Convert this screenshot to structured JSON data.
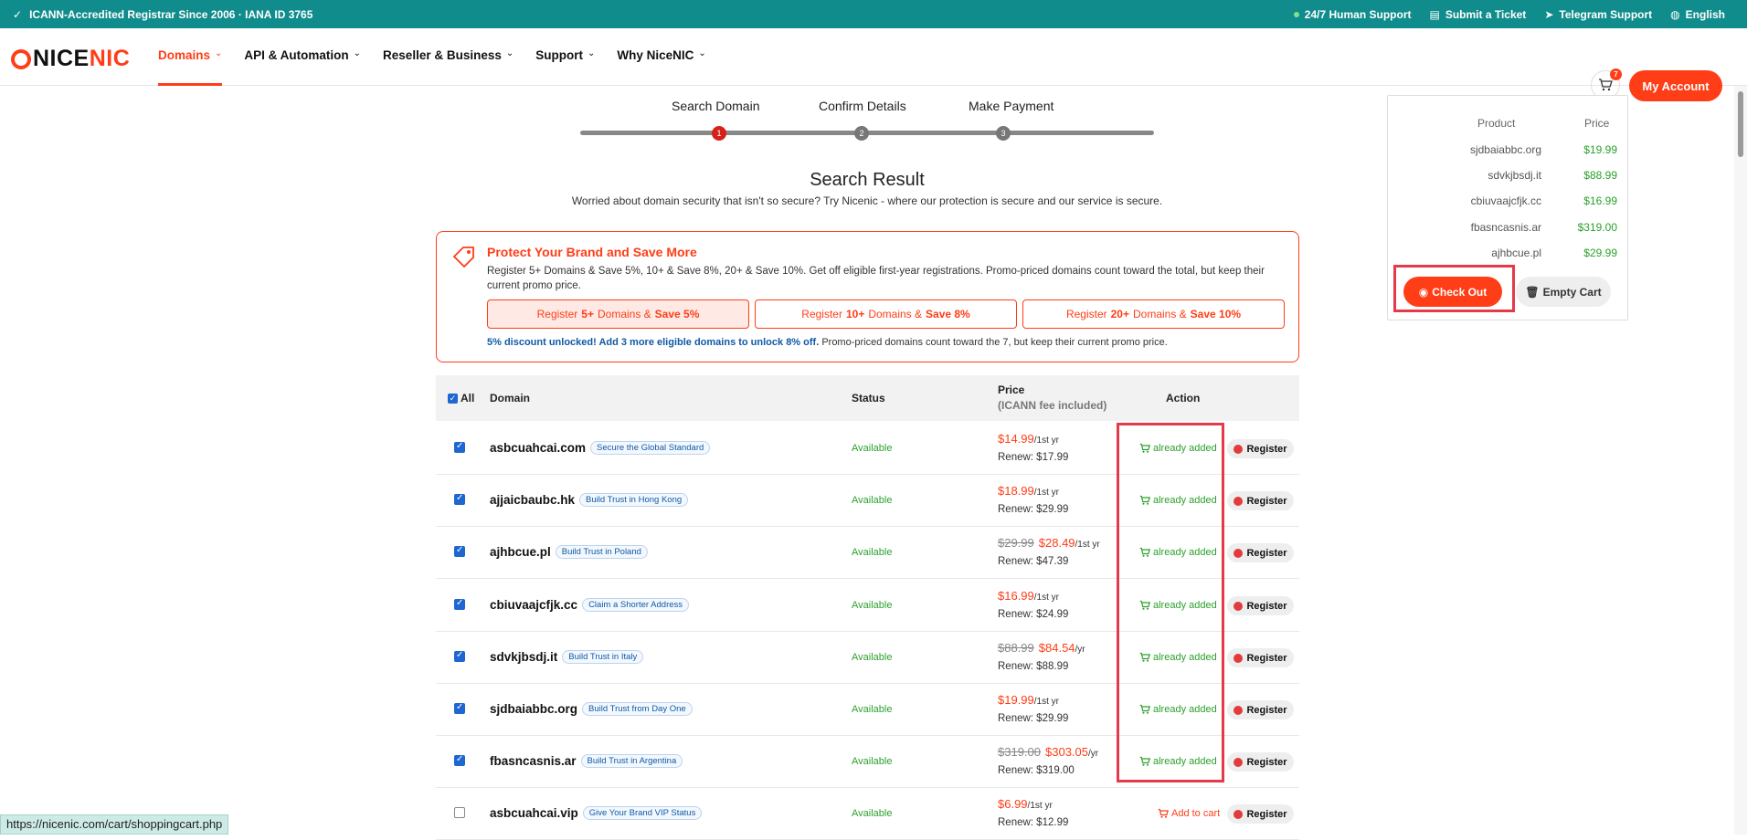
{
  "topbar": {
    "accreditation": "ICANN-Accredited Registrar Since 2006 · IANA ID 3765",
    "support": "24/7 Human Support",
    "ticket": "Submit a Ticket",
    "telegram": "Telegram Support",
    "language": "English"
  },
  "nav": {
    "logo_left": "NICE",
    "logo_right": "NIC",
    "items": [
      {
        "label": "Domains"
      },
      {
        "label": "API & Automation"
      },
      {
        "label": "Reseller & Business"
      },
      {
        "label": "Support"
      },
      {
        "label": "Why NiceNIC"
      }
    ],
    "cart_count": "7",
    "account": "My Account"
  },
  "steps": [
    "Search Domain",
    "Confirm Details",
    "Make Payment"
  ],
  "step_numbers": [
    "1",
    "2",
    "3"
  ],
  "result": {
    "title": "Search Result",
    "subtitle": "Worried about domain security that isn't so secure? Try Nicenic - where our protection is secure and our service is secure."
  },
  "promo": {
    "title": "Protect Your Brand and Save More",
    "desc": "Register 5+ Domains & Save 5%, 10+ & Save 8%, 20+ & Save 10%. Get off eligible first-year registrations. Promo-priced domains count toward the total, but keep their current promo price.",
    "tiers": [
      {
        "pre": "Register",
        "num": "5+",
        "mid": "Domains &",
        "save": "Save 5%"
      },
      {
        "pre": "Register",
        "num": "10+",
        "mid": "Domains &",
        "save": "Save 8%"
      },
      {
        "pre": "Register",
        "num": "20+",
        "mid": "Domains &",
        "save": "Save 10%"
      }
    ],
    "unlock_bold": "5% discount unlocked! Add 3 more eligible domains to unlock 8% off.",
    "unlock_rest": "Promo-priced domains count toward the 7, but keep their current promo price."
  },
  "table": {
    "all": "All",
    "col_domain": "Domain",
    "col_status": "Status",
    "col_price": "Price",
    "col_price_sub": "(ICANN fee included)",
    "col_action": "Action",
    "register": "Register",
    "rows": [
      {
        "domain": "asbcuahcai.com",
        "tag": "Secure the Global Standard",
        "status": "Available",
        "old": "",
        "price": "$14.99",
        "unit": "/1st yr",
        "renew": "Renew: $17.99",
        "action": "already added",
        "checked": true
      },
      {
        "domain": "ajjaicbaubc.hk",
        "tag": "Build Trust in Hong Kong",
        "status": "Available",
        "old": "",
        "price": "$18.99",
        "unit": "/1st yr",
        "renew": "Renew: $29.99",
        "action": "already added",
        "checked": true
      },
      {
        "domain": "ajhbcue.pl",
        "tag": "Build Trust in Poland",
        "status": "Available",
        "old": "$29.99",
        "price": "$28.49",
        "unit": "/1st yr",
        "renew": "Renew: $47.39",
        "action": "already added",
        "checked": true
      },
      {
        "domain": "cbiuvaajcfjk.cc",
        "tag": "Claim a Shorter Address",
        "status": "Available",
        "old": "",
        "price": "$16.99",
        "unit": "/1st yr",
        "renew": "Renew: $24.99",
        "action": "already added",
        "checked": true
      },
      {
        "domain": "sdvkjbsdj.it",
        "tag": "Build Trust in Italy",
        "status": "Available",
        "old": "$88.99",
        "price": "$84.54",
        "unit": "/yr",
        "renew": "Renew: $88.99",
        "action": "already added",
        "checked": true
      },
      {
        "domain": "sjdbaiabbc.org",
        "tag": "Build Trust from Day One",
        "status": "Available",
        "old": "",
        "price": "$19.99",
        "unit": "/1st yr",
        "renew": "Renew: $29.99",
        "action": "already added",
        "checked": true
      },
      {
        "domain": "fbasncasnis.ar",
        "tag": "Build Trust in Argentina",
        "status": "Available",
        "old": "$319.00",
        "price": "$303.05",
        "unit": "/yr",
        "renew": "Renew: $319.00",
        "action": "already added",
        "checked": true
      },
      {
        "domain": "asbcuahcai.vip",
        "tag": "Give Your Brand VIP Status",
        "status": "Available",
        "old": "",
        "price": "$6.99",
        "unit": "/1st yr",
        "renew": "Renew: $12.99",
        "action": "Add to cart",
        "checked": false
      }
    ]
  },
  "cart": {
    "col_product": "Product",
    "col_price": "Price",
    "items": [
      {
        "product": "sjdbaiabbc.org",
        "price": "$19.99"
      },
      {
        "product": "sdvkjbsdj.it",
        "price": "$88.99"
      },
      {
        "product": "cbiuvaajcfjk.cc",
        "price": "$16.99"
      },
      {
        "product": "fbasncasnis.ar",
        "price": "$319.00"
      },
      {
        "product": "ajhbcue.pl",
        "price": "$29.99"
      }
    ],
    "checkout": "Check Out",
    "empty": "Empty Cart"
  },
  "status_url": "https://nicenic.com/cart/shoppingcart.php",
  "colors": {
    "brand": "#ff3d16",
    "teal": "#118c8c",
    "success": "#2ca02c",
    "highlight": "#e53a4a"
  }
}
